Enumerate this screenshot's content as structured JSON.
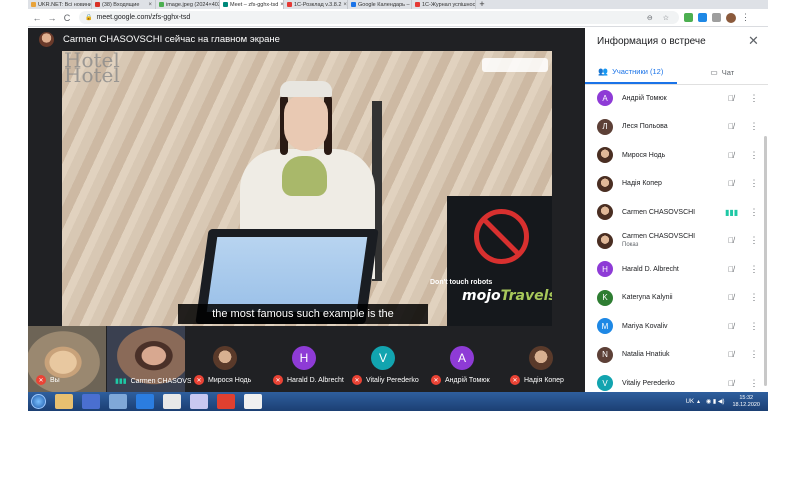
{
  "browser": {
    "tabs": [
      {
        "label": "UKR.NET: Всі новини Укр",
        "color": "#e8a33b"
      },
      {
        "label": "(38) Входящие",
        "color": "#d93025"
      },
      {
        "label": "image.jpeg (2024×4032)",
        "color": "#4caf50"
      },
      {
        "label": "Meet – zfs-gghx-tsd",
        "color": "#00897b",
        "active": true
      },
      {
        "label": "1С-Розклад v.3.8.2",
        "color": "#e53935"
      },
      {
        "label": "Google Календарь – спи",
        "color": "#1a73e8"
      },
      {
        "label": "1С-Журнал успішності",
        "color": "#e53935"
      }
    ],
    "new_tab": "+",
    "url": "meet.google.com/zfs-gghx-tsd",
    "nav": {
      "back": "←",
      "forward": "→",
      "reload": "C"
    },
    "url_icons": "⊖ ☆",
    "menu": "⋮"
  },
  "meet": {
    "presenter": "Carmen CHASOVSCHI сейчас на главном экране",
    "caption": "the most famous such example is the",
    "video": {
      "hotel_text": "Hotel\nHotel",
      "sign_text": "Don't touch robots",
      "brand_a": "mojo",
      "brand_b": "Travels"
    },
    "tiles": [
      {
        "label": "Вы",
        "type": "cam",
        "muted": true
      },
      {
        "label": "Carmen CHASOVSCHI",
        "type": "cam",
        "speaking": true
      },
      {
        "label": "Мирося Нодь",
        "type": "photo",
        "muted": true
      },
      {
        "label": "Harald D. Albrecht",
        "type": "letter",
        "initial": "H",
        "color": "#8e3bd6",
        "muted": true
      },
      {
        "label": "Vitaliy Perederko",
        "type": "letter",
        "initial": "V",
        "color": "#12a4af",
        "muted": true
      },
      {
        "label": "Андрій Томюк",
        "type": "letter",
        "initial": "A",
        "color": "#8e3bd6",
        "muted": true
      },
      {
        "label": "Надія Копер",
        "type": "photo",
        "muted": true
      }
    ]
  },
  "panel": {
    "title": "Информация о встрече",
    "close": "✕",
    "tab_people": "Участники (12)",
    "tab_chat": "Чат",
    "participants": [
      {
        "name": "Андрій Томюк",
        "initial": "A",
        "color": "#8e3bd6",
        "mic": "off"
      },
      {
        "name": "Леся Польова",
        "initial": "Л",
        "color": "#5d4037",
        "mic": "off"
      },
      {
        "name": "Мирося Нодь",
        "photo": true,
        "mic": "off"
      },
      {
        "name": "Надія Копер",
        "photo": true,
        "mic": "off"
      },
      {
        "name": "Carmen CHASOVSCHI",
        "photo": true,
        "mic": "on"
      },
      {
        "name": "Carmen CHASOVSCHI",
        "sub": "Показ",
        "photo": true,
        "mic": "off"
      },
      {
        "name": "Harald D. Albrecht",
        "initial": "H",
        "color": "#8e3bd6",
        "mic": "off"
      },
      {
        "name": "Kateryna Kalynii",
        "initial": "K",
        "color": "#2e7d32",
        "mic": "off"
      },
      {
        "name": "Mariya Kovaliv",
        "initial": "M",
        "color": "#1e88e5",
        "mic": "off"
      },
      {
        "name": "Natalia Hnatiuk",
        "initial": "N",
        "color": "#5d4037",
        "mic": "off"
      },
      {
        "name": "Vitaliy Perederko",
        "initial": "V",
        "color": "#12a4af",
        "mic": "off"
      }
    ]
  },
  "taskbar": {
    "lang": "UK",
    "time": "15:32",
    "date": "18.12.2020",
    "apps": [
      "#e8c070",
      "#4a6fd0",
      "#7fa8d8",
      "#2b7de0",
      "#e8e8e8",
      "#c8c8f0",
      "#e04030",
      "#f0f0f0"
    ]
  }
}
